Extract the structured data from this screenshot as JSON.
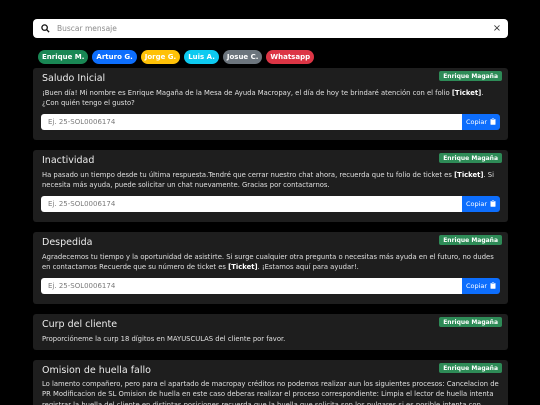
{
  "search": {
    "placeholder": "Buscar mensaje",
    "clear_label": "×"
  },
  "filters": [
    {
      "label": "Enrique M.",
      "color": "#198754"
    },
    {
      "label": "Arturo G.",
      "color": "#0d6efd"
    },
    {
      "label": "Jorge G.",
      "color": "#ffc107"
    },
    {
      "label": "Luis A.",
      "color": "#0dcaf0"
    },
    {
      "label": "Josue C.",
      "color": "#6c757d"
    },
    {
      "label": "Whatsapp",
      "color": "#dc3545"
    }
  ],
  "cards": [
    {
      "title": "Saludo Inicial",
      "author": "Enrique Magaña",
      "message_parts": [
        {
          "text": "¡Buen día! Mi nombre es Enrique Magaña de la Mesa de Ayuda Macropay, el día de hoy te brindaré atención con el folio ",
          "bold": false
        },
        {
          "text": "[Ticket]",
          "bold": true
        },
        {
          "text": ". ¿Con quién tengo el gusto?",
          "bold": false
        }
      ],
      "input_placeholder": "Ej. 25-SOL0006174",
      "copy_label": "Copiar"
    },
    {
      "title": "Inactividad",
      "author": "Enrique Magaña",
      "message_parts": [
        {
          "text": "Ha pasado un tiempo desde tu última respuesta.Tendré que cerrar nuestro chat ahora, recuerda que tu folio de ticket es ",
          "bold": false
        },
        {
          "text": "[Ticket]",
          "bold": true
        },
        {
          "text": ". Si necesita más ayuda, puede solicitar un chat nuevamente. Gracias por contactarnos.",
          "bold": false
        }
      ],
      "input_placeholder": "Ej. 25-SOL0006174",
      "copy_label": "Copiar"
    },
    {
      "title": "Despedida",
      "author": "Enrique Magaña",
      "message_parts": [
        {
          "text": "Agradecemos tu tiempo y la oportunidad de asistirte. Si surge cualquier otra pregunta o necesitas más ayuda en el futuro, no dudes en contactarnos Recuerde que su número de ticket es ",
          "bold": false
        },
        {
          "text": "[Ticket]",
          "bold": true
        },
        {
          "text": ". ¡Estamos aquí para ayudar!.",
          "bold": false
        }
      ],
      "input_placeholder": "Ej. 25-SOL0006174",
      "copy_label": "Copiar"
    },
    {
      "title": "Curp del cliente",
      "author": "Enrique Magaña",
      "message_parts": [
        {
          "text": "Proporcióneme la curp 18 dígitos en MAYUSCULAS del cliente por favor.",
          "bold": false
        }
      ]
    },
    {
      "title": "Omision de huella fallo",
      "author": "Enrique Magaña",
      "message_parts": [
        {
          "text": "Lo lamento compañero, pero para el apartado de macropay créditos no podemos realizar aun los siguientes procesos: Cancelacion de PR Modificacion de SL Omision de huella en este caso deberas realizar el proceso correspondiente: Limpia el lector de huella intenta registrar la huella del cliente en distintas posiciones recuerda que la huella que solicita son los pulgares si es posible intenta con",
          "bold": false
        }
      ]
    }
  ]
}
